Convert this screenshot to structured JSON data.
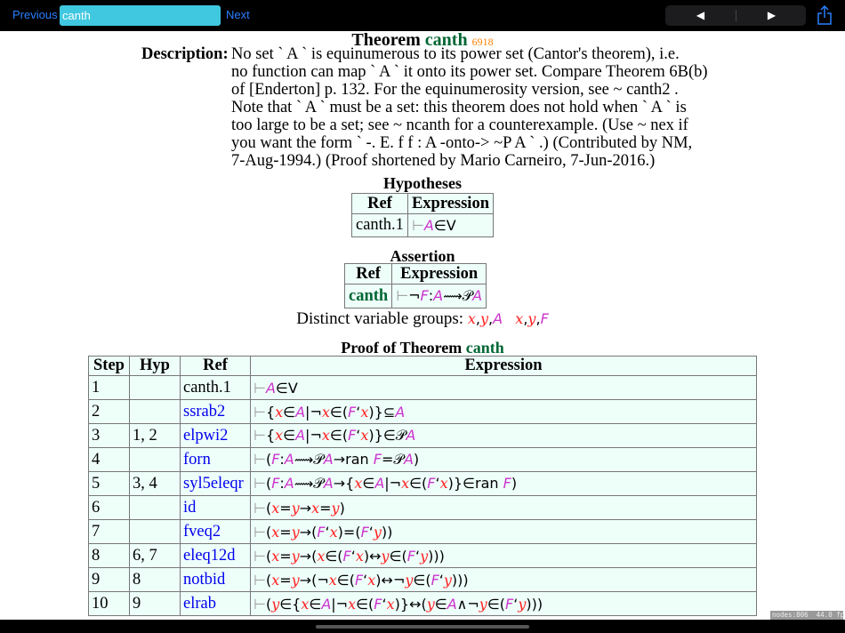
{
  "toolbar": {
    "previous_label": "Previous",
    "search_value": "canth",
    "next_label": "Next",
    "back_icon": "◀",
    "forward_icon": "▶",
    "share_icon": "share-icon"
  },
  "theorem": {
    "word": "Theorem",
    "name": "canth",
    "number": "6918"
  },
  "description": {
    "label": "Description:",
    "lines": [
      "No set ` A ` is equinumerous to its power set (Cantor's theorem), i.e.",
      "no function can map ` A ` it onto its power set.  Compare Theorem 6B(b)",
      "of [Enderton] p. 132.  For the equinumerosity version, see ~ canth2 .",
      "Note that ` A ` must be a set: this theorem does not hold when ` A ` is",
      "too large to be a set; see ~ ncanth for a counterexample.  (Use ~ nex if",
      "you want the form ` -. E. f f : A -onto-> ~P A ` .)  (Contributed by NM,",
      "7-Aug-1994.)  (Proof shortened by Mario Carneiro, 7-Jun-2016.)"
    ]
  },
  "hypotheses": {
    "title": "Hypotheses",
    "headers": [
      "Ref",
      "Expression"
    ],
    "rows": [
      {
        "ref": "canth.1",
        "expr": "⊢A∈V"
      }
    ]
  },
  "assertion": {
    "title": "Assertion",
    "headers": [
      "Ref",
      "Expression"
    ],
    "rows": [
      {
        "ref": "canth",
        "expr": "⊢¬F:A⟿𝒫A"
      }
    ]
  },
  "distinct": {
    "label": "Distinct variable groups:",
    "groups": [
      "x,y,A",
      "x,y,F"
    ]
  },
  "proof": {
    "title_prefix": "Proof of Theorem",
    "title_name": "canth",
    "headers": [
      "Step",
      "Hyp",
      "Ref",
      "Expression"
    ],
    "rows": [
      {
        "step": "1",
        "hyp": "",
        "ref": "canth.1",
        "link": false,
        "expr": "⊢A∈V"
      },
      {
        "step": "2",
        "hyp": "",
        "ref": "ssrab2",
        "link": true,
        "expr": "⊢{x∈A|¬x∈(F‘x)}⊆A"
      },
      {
        "step": "3",
        "hyp": "1, 2",
        "ref": "elpwi2",
        "link": true,
        "expr": "⊢{x∈A|¬x∈(F‘x)}∈𝒫A"
      },
      {
        "step": "4",
        "hyp": "",
        "ref": "forn",
        "link": true,
        "expr": "⊢(F:A⟿𝒫A→ran F=𝒫A)"
      },
      {
        "step": "5",
        "hyp": "3, 4",
        "ref": "syl5eleqr",
        "link": true,
        "expr": "⊢(F:A⟿𝒫A→{x∈A|¬x∈(F‘x)}∈ran F)"
      },
      {
        "step": "6",
        "hyp": "",
        "ref": "id",
        "link": true,
        "expr": "⊢(x=y→x=y)"
      },
      {
        "step": "7",
        "hyp": "",
        "ref": "fveq2",
        "link": true,
        "expr": "⊢(x=y→(F‘x)=(F‘y))"
      },
      {
        "step": "8",
        "hyp": "6, 7",
        "ref": "eleq12d",
        "link": true,
        "expr": "⊢(x=y→(x∈(F‘x)↔y∈(F‘y)))"
      },
      {
        "step": "9",
        "hyp": "8",
        "ref": "notbid",
        "link": true,
        "expr": "⊢(x=y→(¬x∈(F‘x)↔¬y∈(F‘y)))"
      },
      {
        "step": "10",
        "hyp": "9",
        "ref": "elrab",
        "link": true,
        "expr": "⊢(y∈{x∈A|¬x∈(F‘x)}↔(y∈A∧¬y∈(F‘y)))"
      }
    ]
  },
  "debug_overlay": "nodes:806  44.0 fps",
  "colors": {
    "setvar": "#ff2020",
    "classvar": "#cc33cc",
    "turnstile": "#999999",
    "theorem_name": "#006633",
    "theorem_number": "#ff8000",
    "table_bg": "#eefffa",
    "search_bg": "#40c8e0"
  }
}
